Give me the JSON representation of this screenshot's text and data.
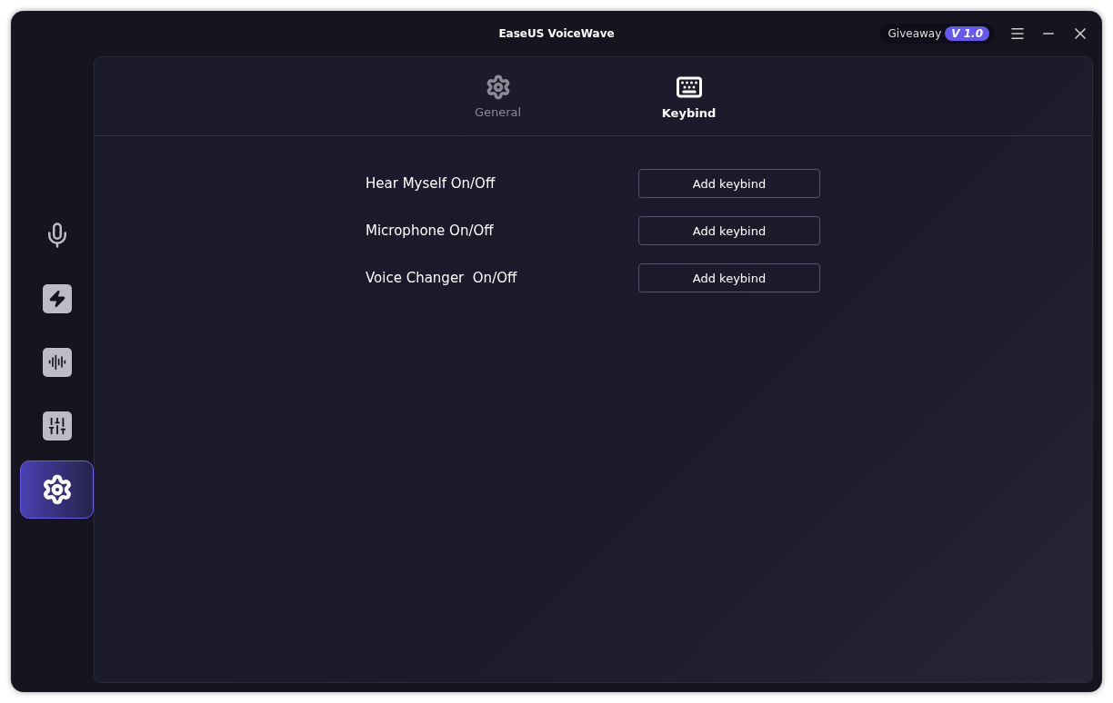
{
  "window": {
    "title": "EaseUS VoiceWave",
    "badge": {
      "label": "Giveaway",
      "version": "V 1.0"
    }
  },
  "sidebar": {
    "items": [
      {
        "kind": "microphone",
        "selected": false
      },
      {
        "kind": "lightning",
        "selected": false
      },
      {
        "kind": "waveform",
        "selected": false
      },
      {
        "kind": "mixer",
        "selected": false
      },
      {
        "kind": "settings",
        "selected": true
      }
    ]
  },
  "tabs": [
    {
      "kind": "gear",
      "label": "General",
      "selected": false
    },
    {
      "kind": "keyboard",
      "label": "Keybind",
      "selected": true
    }
  ],
  "keybinds": [
    {
      "label": "Hear Myself On/Off",
      "button": "Add keybind"
    },
    {
      "label": "Microphone On/Off",
      "button": "Add keybind"
    },
    {
      "label": "Voice Changer  On/Off",
      "button": "Add keybind"
    }
  ]
}
